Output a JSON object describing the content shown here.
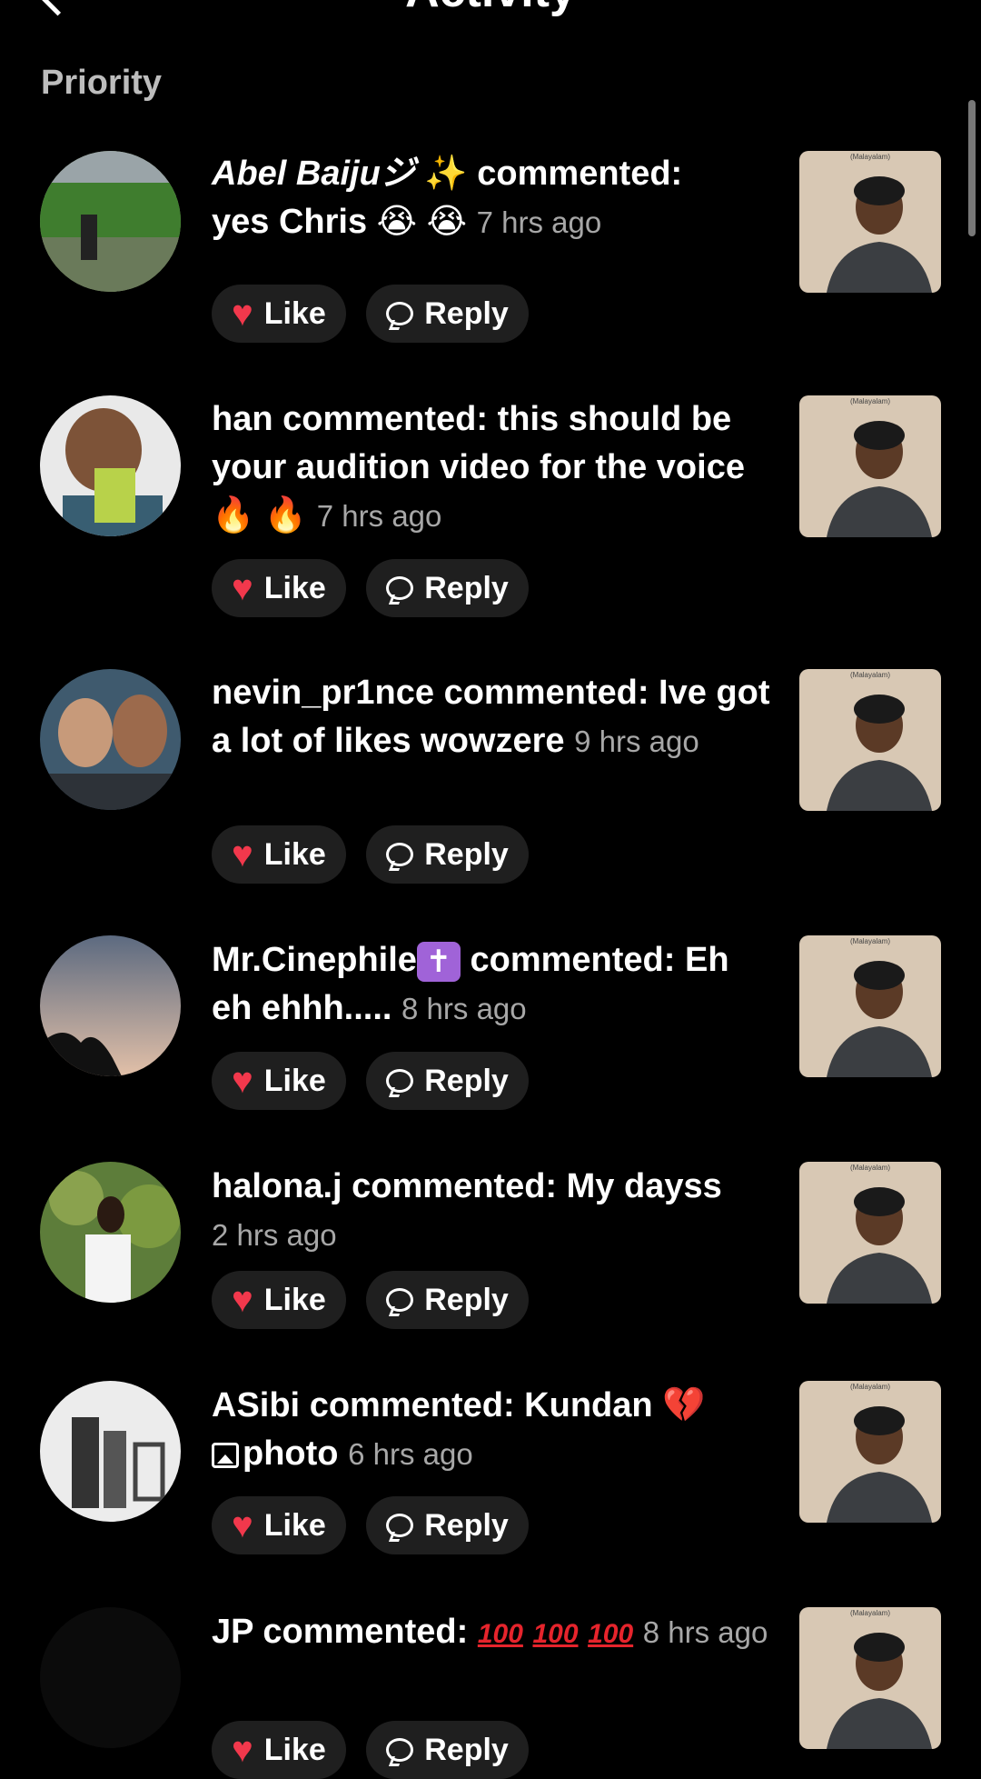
{
  "header": {
    "title": "Activity"
  },
  "section": {
    "label": "Priority"
  },
  "items": [
    {
      "name": "Abel Baijuジ",
      "sparkle": "✨",
      "verb": "commented:",
      "text": "yes Chris",
      "emoji": [
        "😭",
        "😭"
      ],
      "time": "7 hrs ago"
    },
    {
      "name": "han",
      "verb": "commented:",
      "text": "this should be your audition video for the voice",
      "emoji": [
        "🔥",
        "🔥"
      ],
      "time": "7 hrs ago"
    },
    {
      "name": "nevin_pr1nce",
      "verb": "commented:",
      "text": "Ive got a lot of likes wowzere",
      "time": "9 hrs ago"
    },
    {
      "name": "Mr.Cinephile",
      "badge": "✝",
      "verb": "commented:",
      "text": "Eh eh ehhh.....",
      "time": "8 hrs ago"
    },
    {
      "name": "halona.j",
      "verb": "commented:",
      "text": "My dayss",
      "time": "2 hrs ago"
    },
    {
      "name": "ASibi",
      "verb": "commented:",
      "text": "Kundan",
      "emoji": [
        "💔"
      ],
      "photo_label": "photo",
      "time": "6 hrs ago"
    },
    {
      "name": "JP",
      "verb": "commented:",
      "hundreds": [
        "100",
        "100",
        "100"
      ],
      "time": "8 hrs ago"
    }
  ],
  "actions": {
    "like_label": "Like",
    "reply_label": "Reply"
  },
  "thumbnail": {
    "caption": "(Malayalam)"
  },
  "colors": {
    "background": "#000000",
    "like_heart": "#f2384c",
    "pill_bg": "#1f1f1f",
    "timestamp": "#a7a7a7"
  }
}
